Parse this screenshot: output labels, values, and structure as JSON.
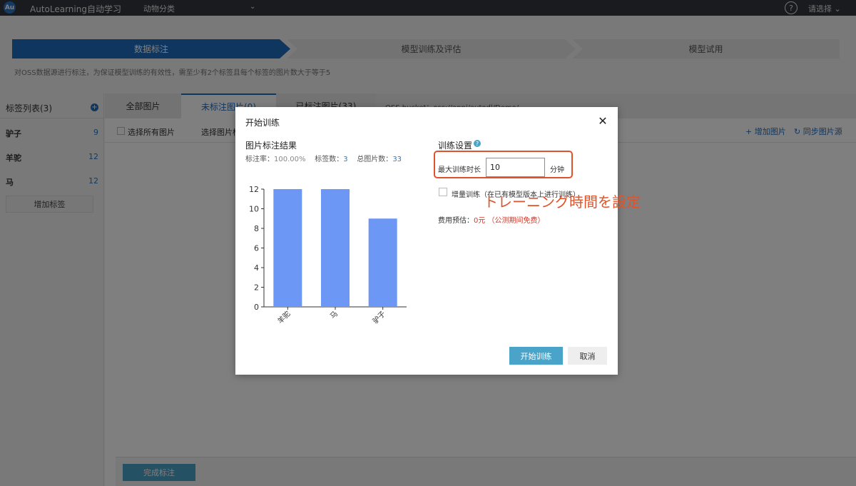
{
  "topbar": {
    "logo_text": "Au",
    "app_title": "AutoLearning自动学习",
    "project": "动物分类",
    "help": "?",
    "lang": "请选择 ⌄"
  },
  "steps": [
    "数据标注",
    "模型训练及评估",
    "模型试用"
  ],
  "hint": "对OSS数据源进行标注，为保证模型训练的有效性，需至少有2个标签且每个标签的图片数大于等于5",
  "sidebar": {
    "title": "标签列表(3)",
    "add": "+",
    "labels": [
      {
        "name": "驴子",
        "count": "9"
      },
      {
        "name": "羊驼",
        "count": "12"
      },
      {
        "name": "马",
        "count": "12"
      }
    ],
    "add_label": "增加标签"
  },
  "tabs": [
    "全部图片",
    "未标注图片(0)",
    "已标注图片(33)"
  ],
  "bucket_text": "OSS bucket：oss://anni/autodl/Demo/",
  "toolbar": {
    "select_all": "选择所有图片",
    "select_img": "选择图片标注",
    "add_img": "+ 增加图片",
    "sync": "↻ 同步图片源"
  },
  "finish_label": "完成标注",
  "modal": {
    "title": "开始训练",
    "close": "✕",
    "left_title": "图片标注结果",
    "stats": {
      "rate_label": "标注率：",
      "rate_value": "100.00%",
      "labels_label": "标签数：",
      "labels_value": "3",
      "total_label": "总图片数：",
      "total_value": "33"
    },
    "right_title": "训练设置",
    "info": "?",
    "duration_label": "最大训练时长",
    "duration_value": "10",
    "duration_unit": "分钟",
    "incremental_label": "增量训练（在已有模型版本上进行训练）",
    "annotation": "トレーニング時間を設定",
    "cost_label": "费用预估：",
    "cost_value": "0元 （公测期间免费）",
    "start_btn": "开始训练",
    "cancel_btn": "取消"
  },
  "chart_data": {
    "type": "bar",
    "categories": [
      "羊驼",
      "马",
      "驴子"
    ],
    "values": [
      12,
      12,
      9
    ],
    "ylim": [
      0,
      12
    ],
    "yticks": [
      0,
      2,
      4,
      6,
      8,
      10,
      12
    ],
    "bar_color": "#6c97f4",
    "grid": false
  },
  "colors": {
    "accent": "#1f6cbf",
    "button": "#4aa3c8",
    "highlight": "#e0532a"
  }
}
